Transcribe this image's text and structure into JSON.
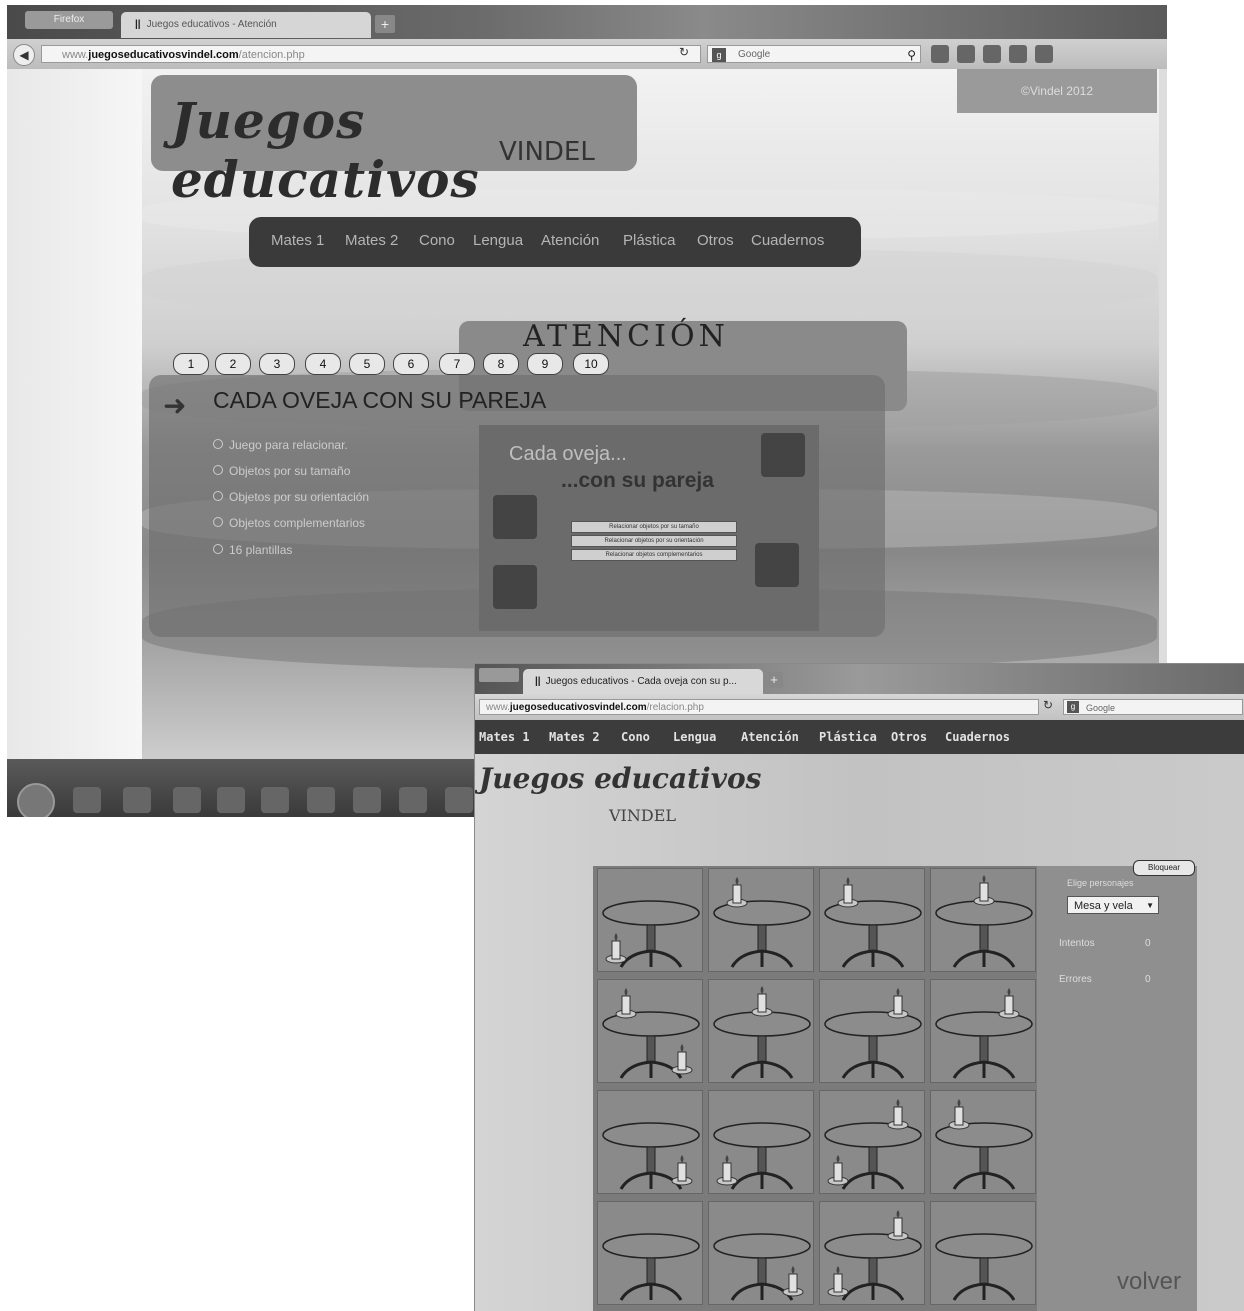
{
  "window1": {
    "browser_menu": "Firefox",
    "tab_title": "Juegos educativos - Atención",
    "new_tab": "+",
    "url_prefix": "www.",
    "url_domain": "juegoseducativosvindel.com",
    "url_path": "/atencion.php",
    "search_engine": "Google",
    "copyright": "©Vindel 2012",
    "logo_script": "Juegos educativos",
    "logo_name": "VINDEL",
    "nav": [
      "Mates 1",
      "Mates 2",
      "Cono",
      "Lengua",
      "Atención",
      "Plástica",
      "Otros",
      "Cuadernos"
    ],
    "section_title": "ATENCIÓN",
    "page_numbers": [
      "1",
      "2",
      "3",
      "4",
      "5",
      "6",
      "7",
      "8",
      "9",
      "10"
    ],
    "game_title": "CADA OVEJA CON SU PAREJA",
    "options": [
      "Juego para relacionar.",
      "Objetos por su tamaño",
      "Objetos por su orientación",
      "Objetos complementarios",
      "16 plantillas"
    ],
    "preview": {
      "title_line1": "Cada oveja...",
      "title_line2": "...con su pareja",
      "buttons": [
        "Relacionar objetos por su tamaño",
        "Relacionar objetos por su orientación",
        "Relacionar objetos complementarios"
      ]
    }
  },
  "window2": {
    "tab_title": "Juegos educativos - Cada oveja con su p...",
    "new_tab": "+",
    "url_prefix": "www.",
    "url_domain": "juegoseducativosvindel.com",
    "url_path": "/relacion.php",
    "search_engine": "Google",
    "nav": [
      "Mates 1",
      "Mates 2",
      "Cono",
      "Lengua",
      "Atención",
      "Plástica",
      "Otros",
      "Cuadernos"
    ],
    "logo_script": "Juegos educativos",
    "logo_name": "VINDEL",
    "bloquear": "Bloquear",
    "elige_label": "Elige personajes",
    "select_value": "Mesa y vela",
    "intentos_label": "Intentos",
    "intentos_value": "0",
    "errores_label": "Errores",
    "errores_value": "0",
    "volver": "volver",
    "board_candle_positions": [
      "under-left",
      "top-left",
      "top-left",
      "top-center",
      "top-left+under-right",
      "top-center",
      "top-right",
      "top-right",
      "under-right",
      "under-left",
      "top-right+under-left",
      "top-left",
      "none",
      "under-right",
      "top-right+under-left",
      "none"
    ]
  }
}
